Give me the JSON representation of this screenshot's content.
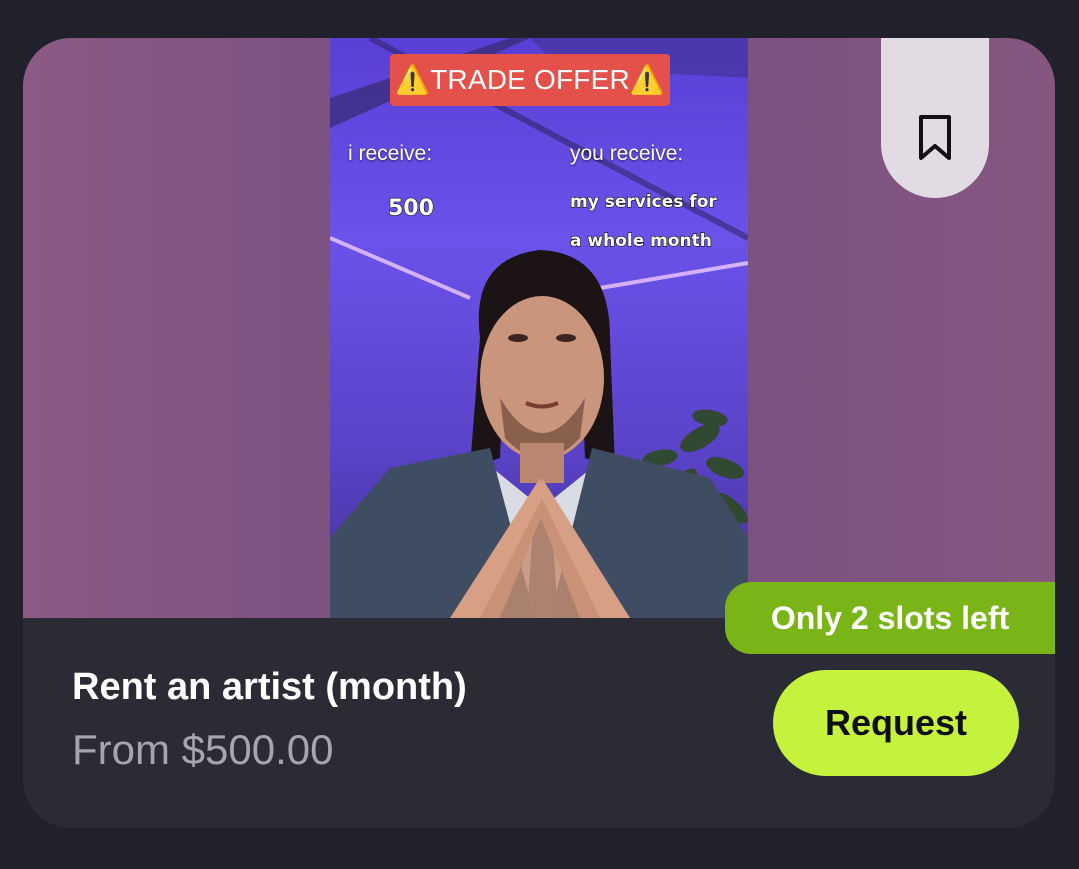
{
  "listing": {
    "title": "Rent an artist (month)",
    "price": "From $500.00",
    "slots_badge": "Only 2 slots left",
    "request_label": "Request",
    "bookmark_icon": "bookmark-icon"
  },
  "video": {
    "banner": "⚠️TRADE OFFER⚠️",
    "left_heading": "i receive:",
    "left_value": "500",
    "right_heading": "you receive:",
    "right_line1": "my services for",
    "right_line2": "a whole month"
  },
  "colors": {
    "background": "#21212b",
    "card_footer": "#2b2b35",
    "media_bg": "#7c5281",
    "badge": "#7ab517",
    "request_button": "#c5f23d",
    "bookmark_tab": "#e3dbe4",
    "banner": "#e4504a"
  }
}
